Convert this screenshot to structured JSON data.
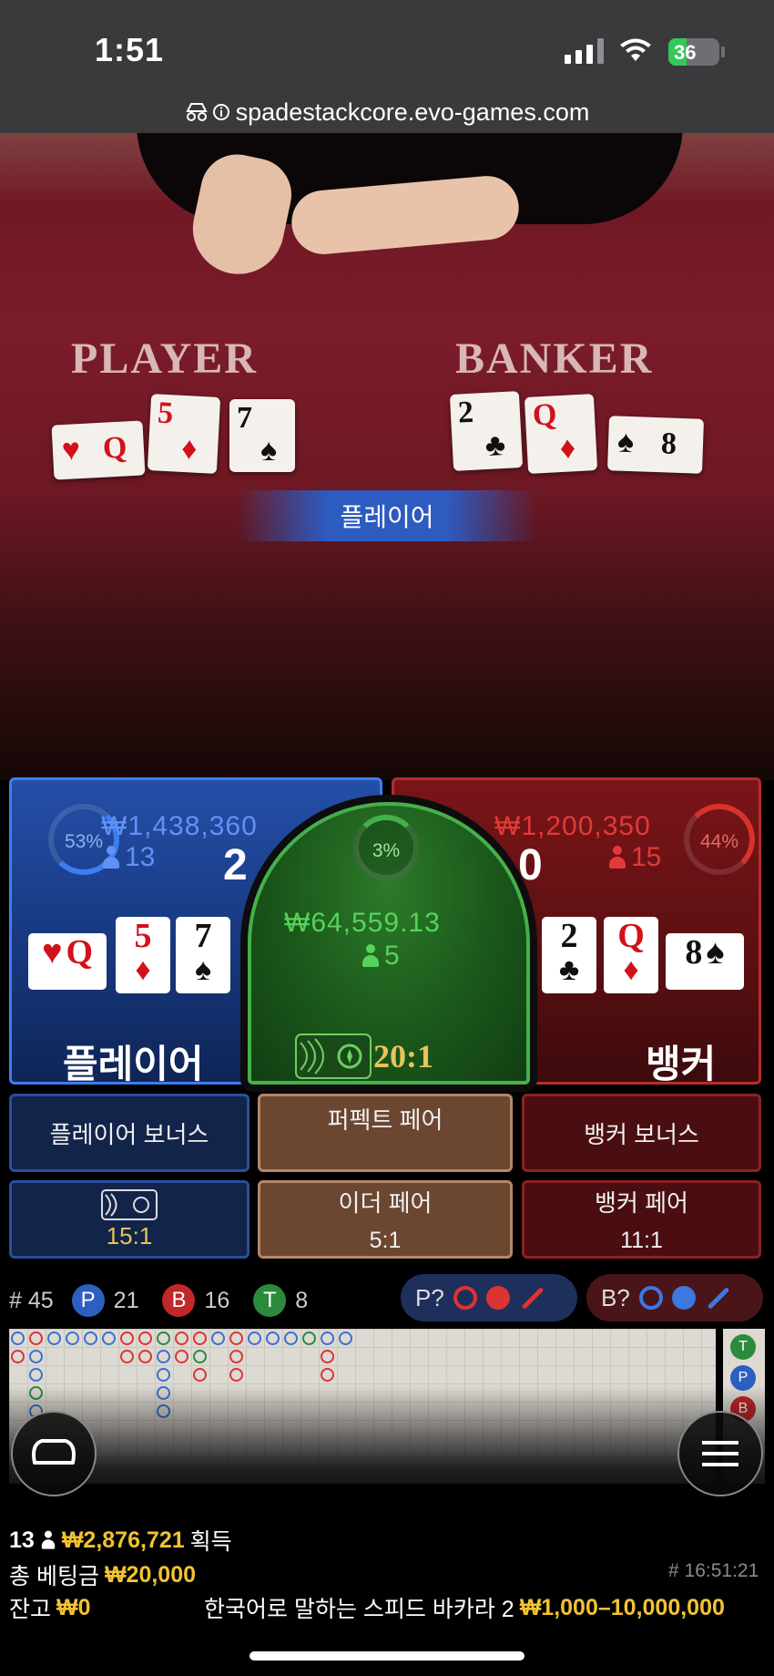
{
  "status_bar": {
    "time": "1:51",
    "battery": "36",
    "battery_level": 0.36
  },
  "browser": {
    "url": "spadestackcore.evo-games.com"
  },
  "table": {
    "player_label": "PLAYER",
    "banker_label": "BANKER",
    "player_cards": [
      {
        "rank": "Q",
        "suit": "♥",
        "color": "red"
      },
      {
        "rank": "5",
        "suit": "♦",
        "color": "red"
      },
      {
        "rank": "7",
        "suit": "♠",
        "color": "black"
      }
    ],
    "banker_cards": [
      {
        "rank": "2",
        "suit": "♣",
        "color": "black"
      },
      {
        "rank": "Q",
        "suit": "♦",
        "color": "red"
      },
      {
        "rank": "8",
        "suit": "♠",
        "color": "black"
      }
    ],
    "result_banner": "플레이어"
  },
  "player_bet": {
    "percent": "53%",
    "percent_value": 53,
    "amount": "₩1,438,360",
    "players": "13",
    "score": "2",
    "label": "플레이어",
    "cards": [
      {
        "rank": "Q",
        "suit": "♥",
        "color": "red"
      },
      {
        "rank": "5",
        "suit": "♦",
        "color": "red"
      },
      {
        "rank": "7",
        "suit": "♠",
        "color": "black"
      }
    ]
  },
  "tie_bet": {
    "percent": "3%",
    "percent_value": 3,
    "amount": "₩64,559.13",
    "players": "5",
    "odds": "20:1"
  },
  "banker_bet": {
    "percent": "44%",
    "percent_value": 44,
    "amount": "₩1,200,350",
    "players": "15",
    "score": "0",
    "label": "뱅커",
    "cards": [
      {
        "rank": "2",
        "suit": "♣",
        "color": "black"
      },
      {
        "rank": "Q",
        "suit": "♦",
        "color": "red"
      },
      {
        "rank": "8",
        "suit": "♠",
        "color": "black"
      }
    ]
  },
  "side_bets": {
    "player_bonus": "플레이어 보너스",
    "perfect_pair": "퍼펙트 페어",
    "banker_bonus": "뱅커 보너스",
    "player_pair_odds": "15:1",
    "either_pair": "이더 페어",
    "either_pair_odds": "5:1",
    "banker_pair": "뱅커 페어",
    "banker_pair_odds": "11:1"
  },
  "stats": {
    "round": "# 45",
    "p_letter": "P",
    "p_count": "21",
    "b_letter": "B",
    "b_count": "16",
    "t_letter": "T",
    "t_count": "8",
    "player_predict": "P?",
    "banker_predict": "B?"
  },
  "road_mini_letters": [
    "T",
    "P",
    "B"
  ],
  "footer": {
    "winners": "13",
    "win_amount": "₩2,876,721",
    "win_label": "획득",
    "total_bet_label": "총 베팅금",
    "total_bet": "₩20,000",
    "time": "# 16:51:21",
    "balance_label": "잔고",
    "balance": "₩0",
    "table_name": "한국어로 말하는 스피드 바카라 2",
    "limits": "₩1,000–10,000,000"
  },
  "colors": {
    "player_blue": "#3d7ef0",
    "banker_red": "#d8322f",
    "tie_green": "#45b04a",
    "gold": "#f1c232"
  }
}
